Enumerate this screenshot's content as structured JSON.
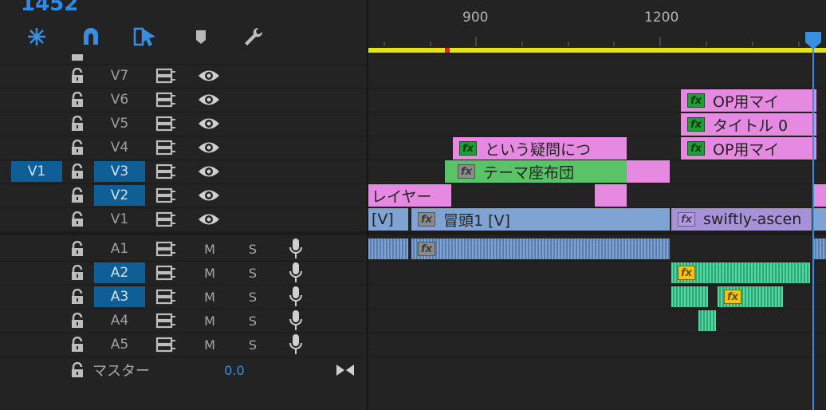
{
  "timecode": "1452",
  "toolbar": [
    {
      "name": "snap-ripple-icon"
    },
    {
      "name": "magnet-snap-icon"
    },
    {
      "name": "linked-selection-icon"
    },
    {
      "name": "add-marker-icon"
    },
    {
      "name": "wrench-settings-icon"
    }
  ],
  "ruler": {
    "ticks": [
      "900",
      "1200"
    ]
  },
  "video_tracks": [
    {
      "id": "v7",
      "label": "V7",
      "src": ""
    },
    {
      "id": "v6",
      "label": "V6",
      "src": ""
    },
    {
      "id": "v5",
      "label": "V5",
      "src": ""
    },
    {
      "id": "v4",
      "label": "V4",
      "src": ""
    },
    {
      "id": "v3",
      "label": "V3",
      "src": "V1",
      "selected": true
    },
    {
      "id": "v2",
      "label": "V2",
      "src": "",
      "selected": true
    },
    {
      "id": "v1",
      "label": "V1",
      "src": ""
    }
  ],
  "audio_tracks": [
    {
      "id": "a1",
      "label": "A1",
      "m": "M",
      "s": "S"
    },
    {
      "id": "a2",
      "label": "A2",
      "m": "M",
      "s": "S",
      "selected": true
    },
    {
      "id": "a3",
      "label": "A3",
      "m": "M",
      "s": "S",
      "selected": true
    },
    {
      "id": "a4",
      "label": "A4",
      "m": "M",
      "s": "S"
    },
    {
      "id": "a5",
      "label": "A5",
      "m": "M",
      "s": "S"
    }
  ],
  "master": {
    "label": "マスター",
    "value": "0.0"
  },
  "clips": {
    "v6": "OP用マイ",
    "v5": "タイトル 0",
    "v4_right": "OP用マイ",
    "v4_left": "という疑問につ",
    "v3": "テーマ座布団",
    "v2": "レイヤー",
    "v1_a": "[V]",
    "v1_b": "冒頭1 [V]",
    "v1_c": "swiftly-ascen"
  },
  "colors": {
    "accent": "#2d8ceb",
    "selected_track": "#0f5e96",
    "pink_clip": "#e58ae0",
    "green_clip": "#5bc367",
    "blue_clip": "#7fa4d4",
    "purple_clip": "#a592d9",
    "audio_green": "#3cc493",
    "work_area": "#e6e21a"
  }
}
